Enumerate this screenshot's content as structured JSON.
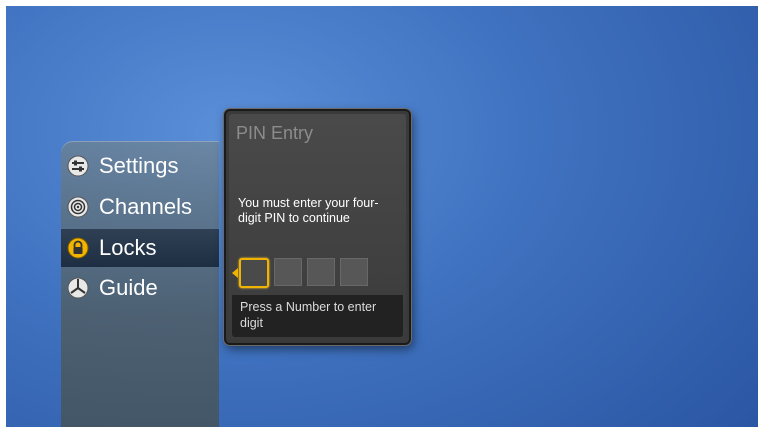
{
  "menu": {
    "items": [
      {
        "label": "Settings",
        "icon": "settings-icon"
      },
      {
        "label": "Channels",
        "icon": "channels-icon"
      },
      {
        "label": "Locks",
        "icon": "lock-icon",
        "selected": true
      },
      {
        "label": "Guide",
        "icon": "guide-icon"
      }
    ]
  },
  "dialog": {
    "title": "PIN Entry",
    "message": "You must enter your four-digit PIN to continue",
    "pin_digits": 4,
    "active_digit": 1,
    "footer": "Press a Number to enter digit"
  },
  "colors": {
    "accent": "#f0b400",
    "background": "#3f72c0"
  }
}
